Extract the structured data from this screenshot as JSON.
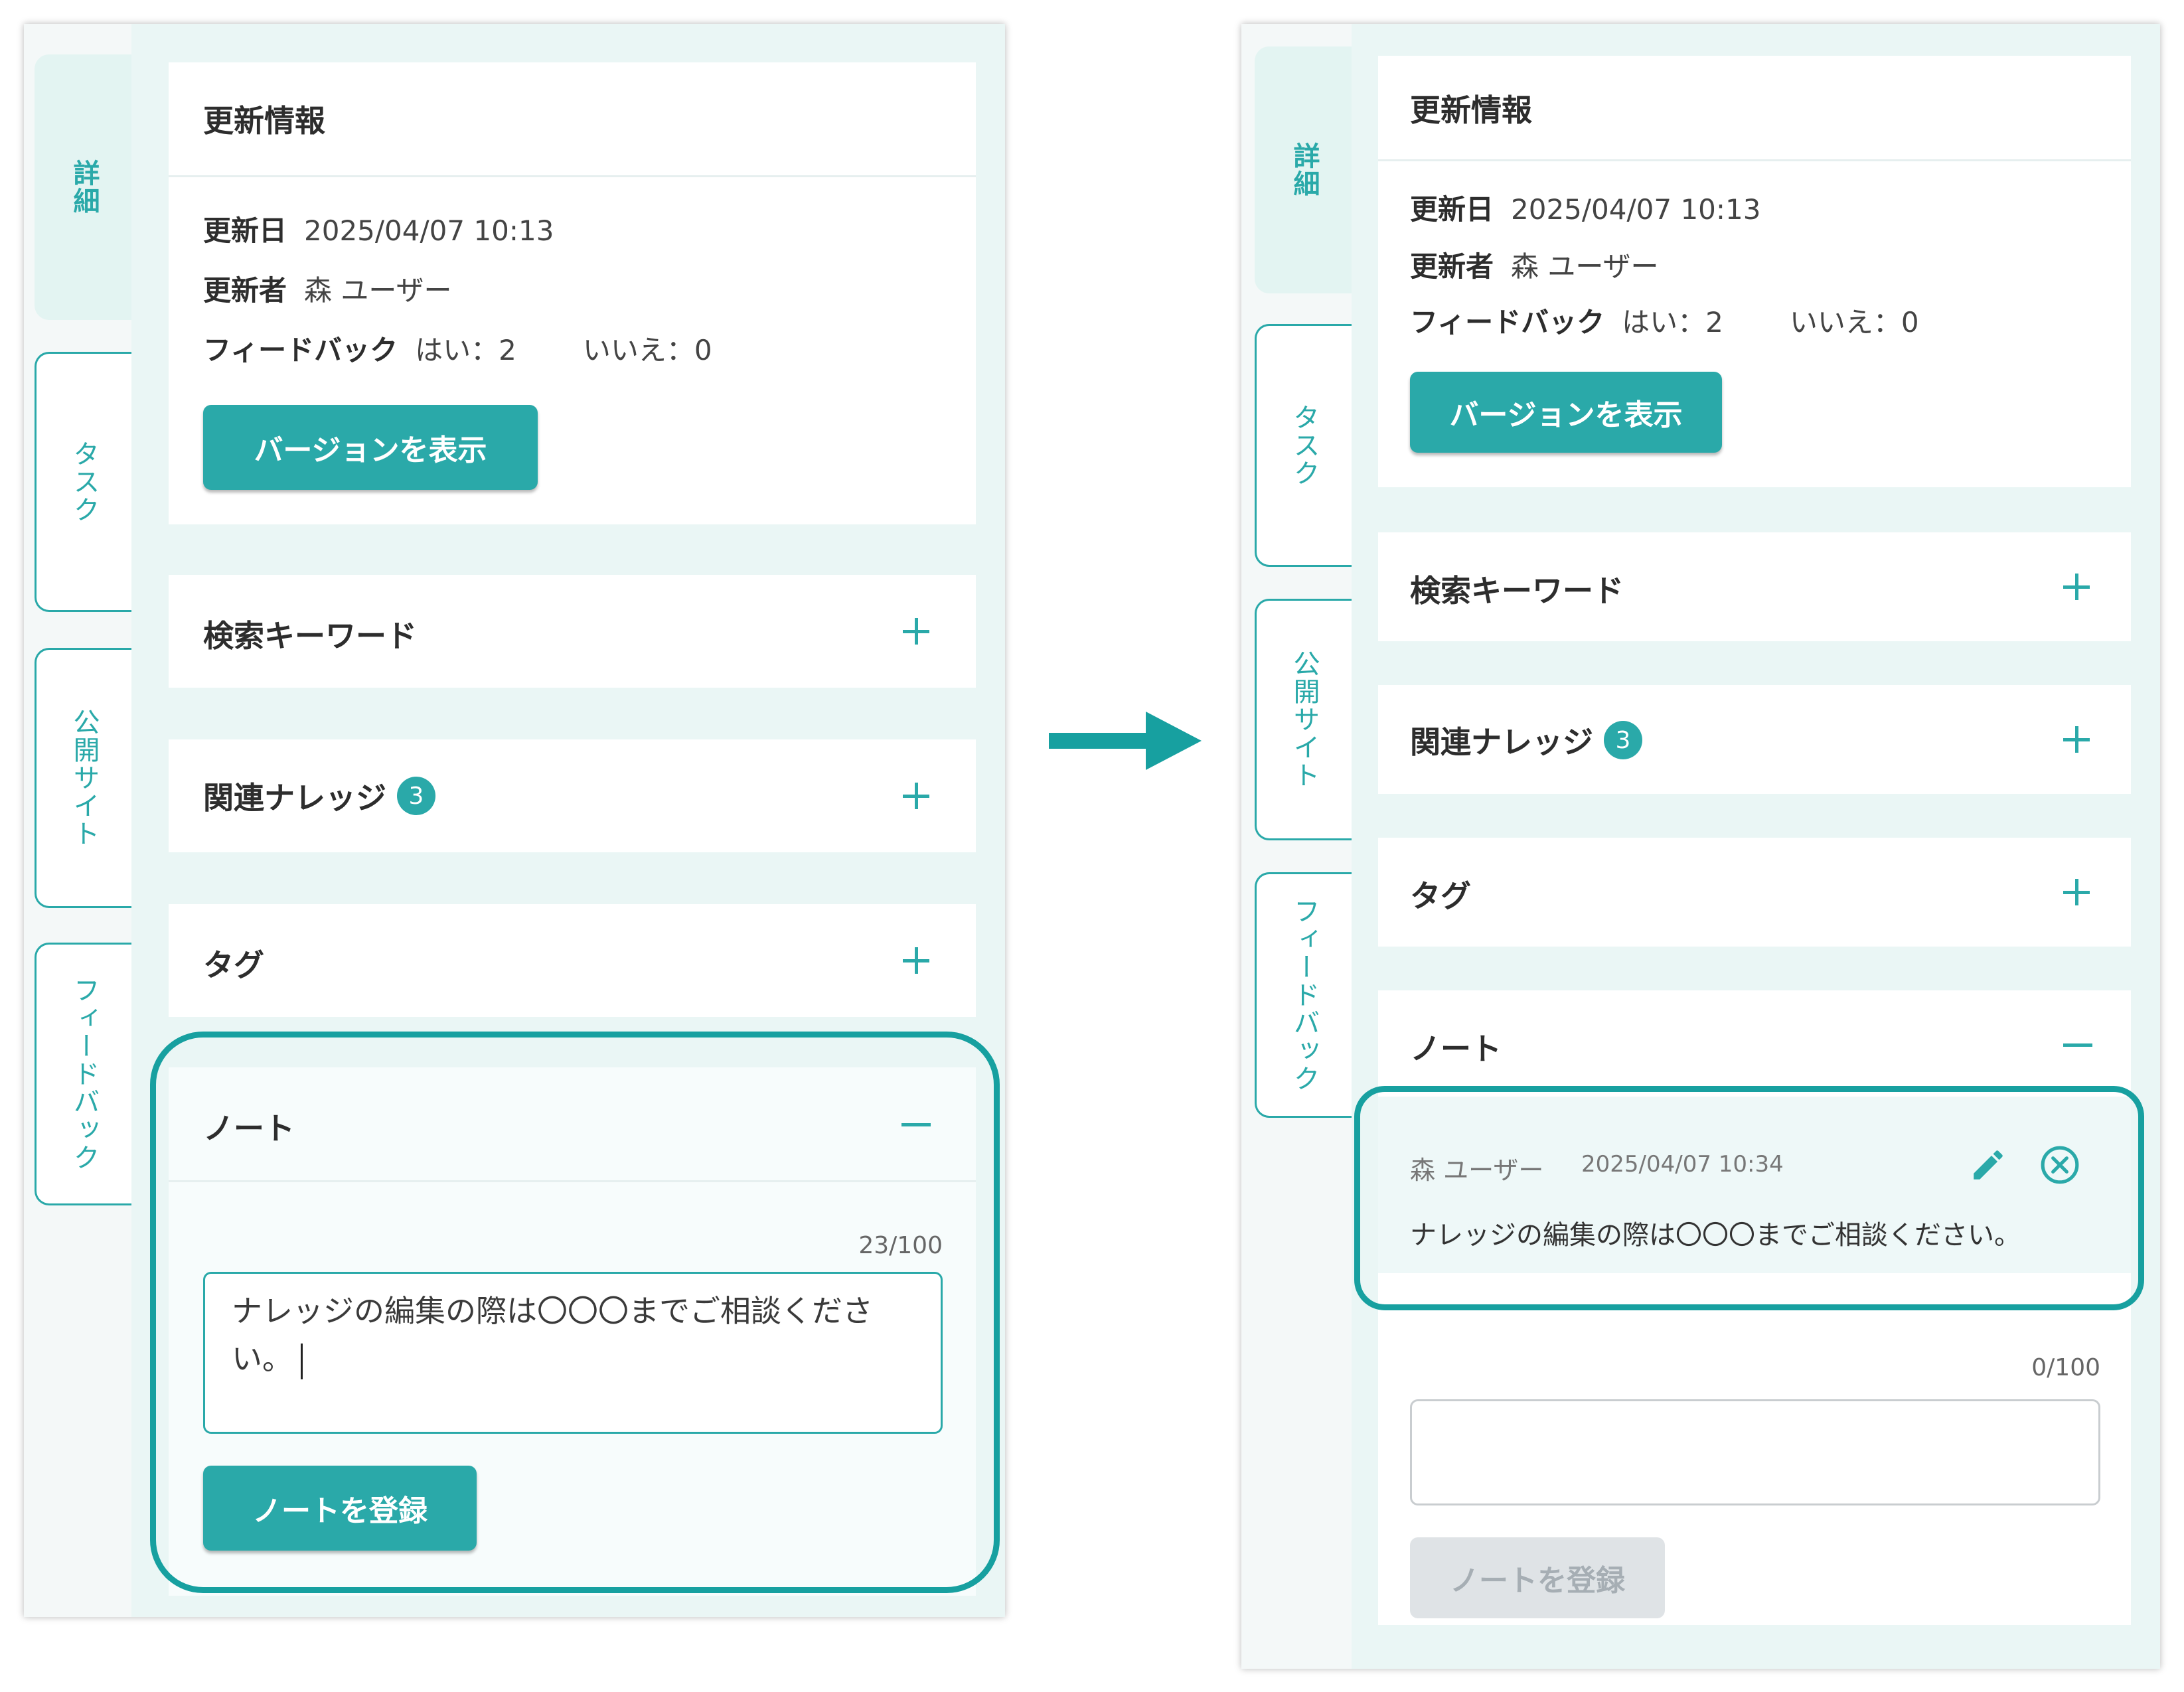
{
  "before": {
    "tabs": [
      "詳細",
      "タスク",
      "公開サイト",
      "フィードバック"
    ],
    "update_info": {
      "title": "更新情報",
      "updated_date_label": "更新日",
      "updated_date_value": "2025/04/07 10:13",
      "updater_label": "更新者",
      "updater_value": "森 ユーザー",
      "feedback_label": "フィードバック",
      "feedback_yes": "はい：2",
      "feedback_no": "いいえ：0",
      "version_button": "バージョンを表示"
    },
    "keywords_title": "検索キーワード",
    "related_title": "関連ナレッジ",
    "related_count": "3",
    "tags_title": "タグ",
    "note": {
      "title": "ノート",
      "counter": "23/100",
      "input_value": "ナレッジの編集の際は〇〇〇までご相談くださ",
      "input_value_line2": "い。",
      "submit_button": "ノートを登録"
    }
  },
  "after": {
    "tabs": [
      "詳細",
      "タスク",
      "公開サイト",
      "フィードバック"
    ],
    "update_info": {
      "title": "更新情報",
      "updated_date_label": "更新日",
      "updated_date_value": "2025/04/07 10:13",
      "updater_label": "更新者",
      "updater_value": "森 ユーザー",
      "feedback_label": "フィードバック",
      "feedback_yes": "はい：2",
      "feedback_no": "いいえ：0",
      "version_button": "バージョンを表示"
    },
    "keywords_title": "検索キーワード",
    "related_title": "関連ナレッジ",
    "related_count": "3",
    "tags_title": "タグ",
    "note": {
      "title": "ノート",
      "entry_author": "森 ユーザー",
      "entry_time": "2025/04/07 10:34",
      "entry_text": "ナレッジの編集の際は〇〇〇までご相談ください。",
      "counter": "0/100",
      "input_value": "",
      "submit_button": "ノートを登録"
    }
  },
  "colors": {
    "accent": "#2aa9a9",
    "highlight_outline": "#17a0a0",
    "panel_background": "#eaf6f5",
    "disabled_button": "#dfe3e6"
  },
  "icons": {
    "arrow": "right-arrow-icon",
    "expand": "plus-icon",
    "collapse": "minus-icon",
    "edit": "pencil-icon",
    "delete": "circle-x-icon"
  }
}
